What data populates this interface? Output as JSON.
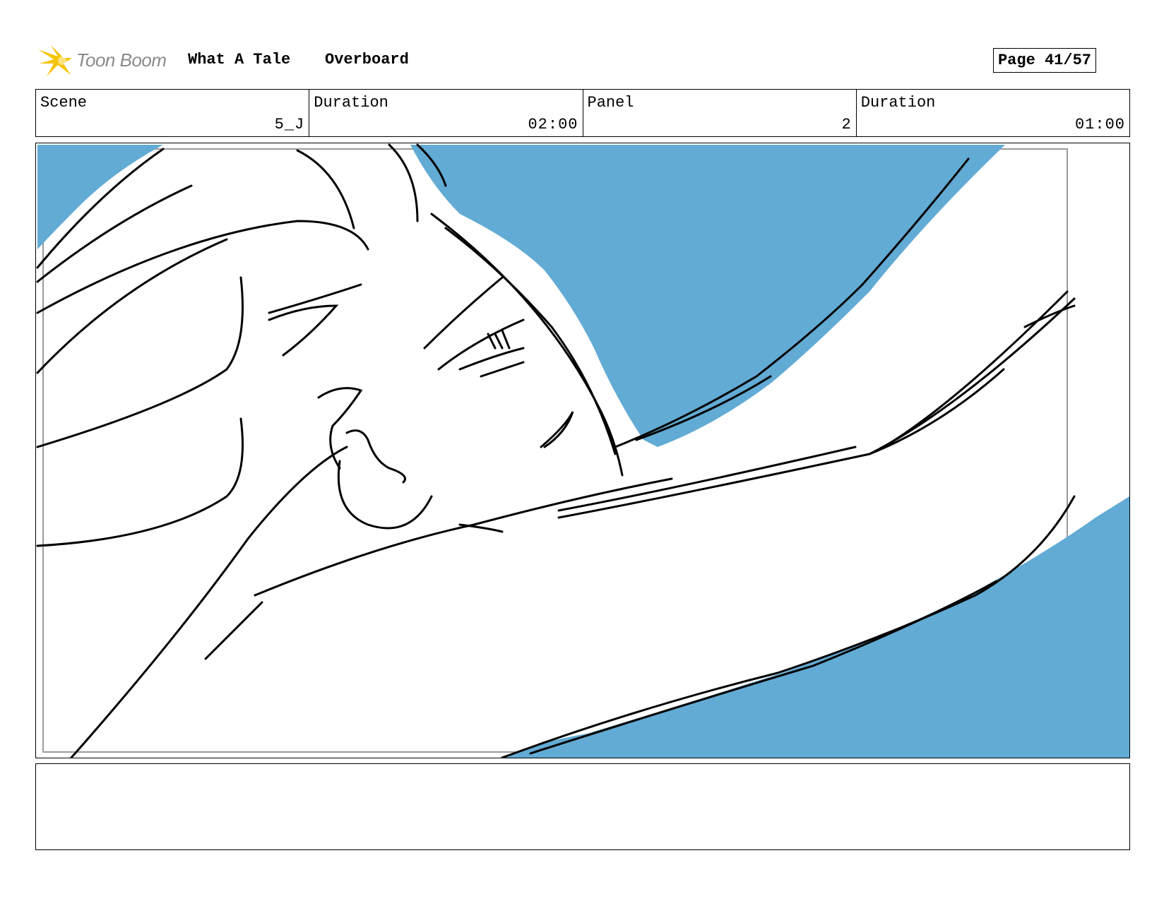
{
  "header": {
    "logo_text": "Toon Boom",
    "project_title": "What A Tale",
    "episode_title": "Overboard",
    "page_label": "Page 41/57"
  },
  "info": {
    "scene_label": "Scene",
    "scene_value": "5_J",
    "scene_duration_label": "Duration",
    "scene_duration_value": "02:00",
    "panel_label": "Panel",
    "panel_value": "2",
    "panel_duration_label": "Duration",
    "panel_duration_value": "01:00"
  },
  "colors": {
    "background_blue": "#62abd4",
    "logo_yellow": "#f5c400",
    "logo_grey": "#8a8a8a"
  },
  "notes": {
    "text": ""
  }
}
